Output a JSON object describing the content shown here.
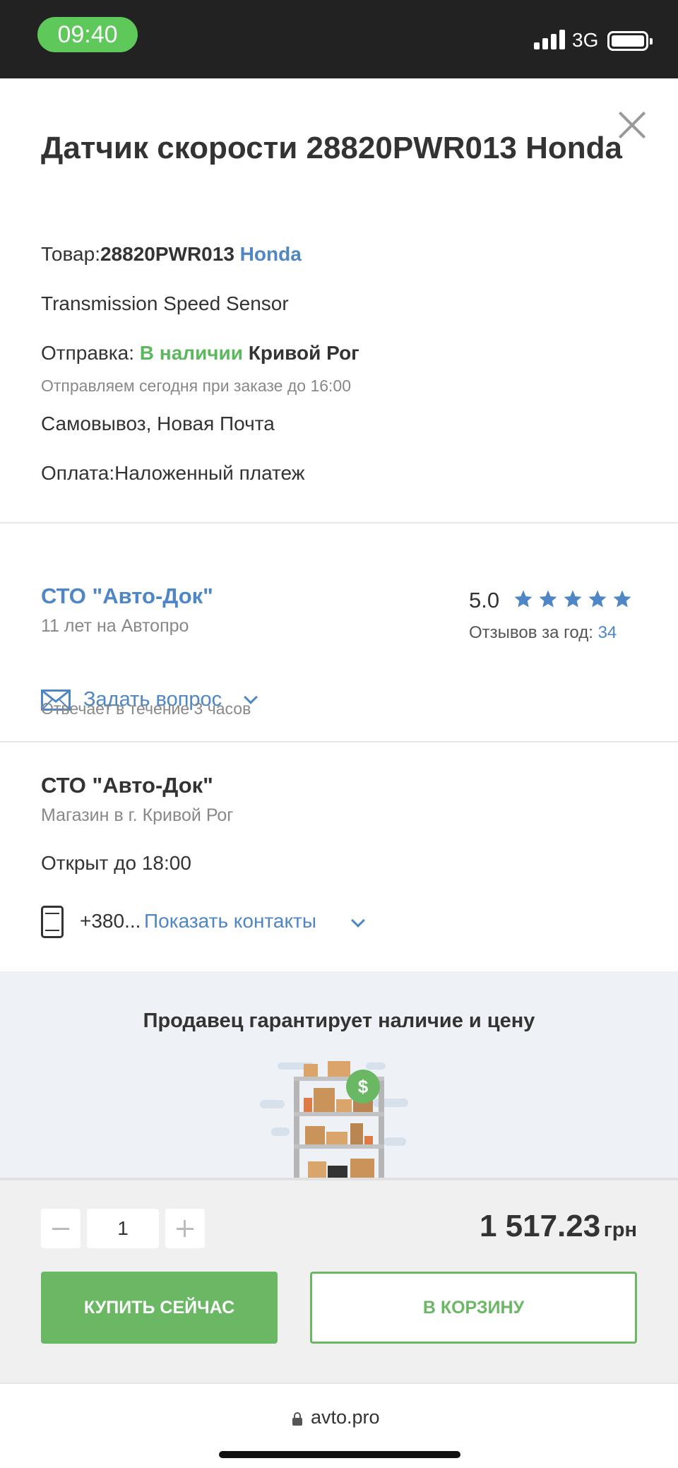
{
  "status_bar": {
    "time": "09:40",
    "network": "3G"
  },
  "product": {
    "title": "Датчик скорости 28820PWR013 Honda",
    "item_label": "Товар:",
    "item_code": "28820PWR013",
    "brand": "Honda",
    "description": "Transmission Speed Sensor",
    "shipping_label": "Отправка:",
    "availability": "В наличии",
    "city": "Кривой Рог",
    "shipping_note": "Отправляем сегодня при заказе до 16:00",
    "delivery": "Самовывоз, Новая Почта",
    "payment": "Оплата:Наложенный платеж"
  },
  "seller": {
    "name": "СТО \"Авто-Док\"",
    "years": "11 лет на Автопро",
    "rating": "5.0",
    "rating_stars": 5,
    "reviews_label": "Отзывов за год:",
    "reviews_count": "34",
    "ask_question": "Задать вопрос",
    "replies_note": "Отвечает в течение 3 часов"
  },
  "shop": {
    "name": "СТО \"Авто-Док\"",
    "city": "Магазин в г. Кривой Рог",
    "open_until": "Открыт до 18:00",
    "phone_partial": "+380...",
    "show_contacts": "Показать контакты"
  },
  "guarantee": {
    "title": "Продавец гарантирует наличие и цену"
  },
  "order": {
    "quantity": "1",
    "price": "1 517.23",
    "currency": "грн",
    "buy_now": "КУПИТЬ СЕЙЧАС",
    "add_to_cart": "В КОРЗИНУ"
  },
  "browser": {
    "url": "avto.pro"
  },
  "colors": {
    "link": "#4f86c6",
    "accent_green": "#6ab863",
    "in_stock": "#5cb85c",
    "star": "#4f86c6"
  },
  "icons": [
    "close-icon",
    "star-icon",
    "mail-icon",
    "chevron-down-icon",
    "phone-icon",
    "minus-icon",
    "plus-icon",
    "lock-icon"
  ]
}
